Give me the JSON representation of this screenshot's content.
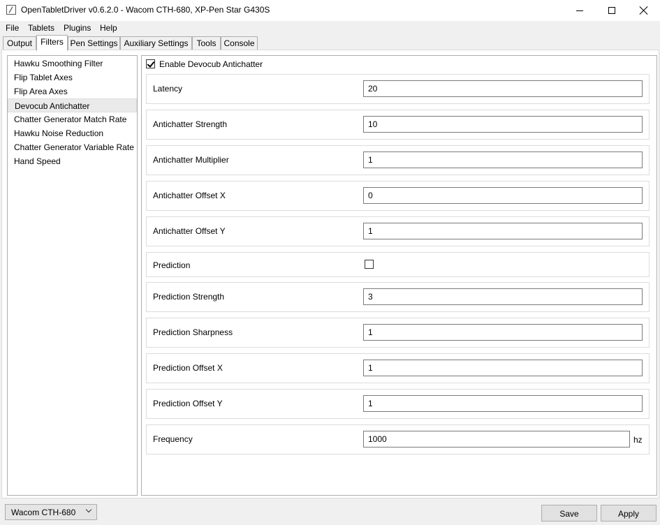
{
  "window": {
    "title": "OpenTabletDriver v0.6.2.0 - Wacom CTH-680, XP-Pen Star G430S"
  },
  "menu": {
    "items": [
      "File",
      "Tablets",
      "Plugins",
      "Help"
    ]
  },
  "tabs": {
    "items": [
      "Output",
      "Filters",
      "Pen Settings",
      "Auxiliary Settings",
      "Tools",
      "Console"
    ],
    "active": "Filters"
  },
  "filters": {
    "items": [
      "Hawku Smoothing Filter",
      "Flip Tablet Axes",
      "Flip Area Axes",
      "Devocub Antichatter",
      "Chatter Generator Match Rate",
      "Hawku Noise Reduction",
      "Chatter Generator Variable Rate",
      "Hand Speed"
    ],
    "selected": "Devocub Antichatter"
  },
  "settings": {
    "enable_label": "Enable Devocub Antichatter",
    "enable_checked": true,
    "latency": {
      "label": "Latency",
      "value": "20"
    },
    "antichatter_strength": {
      "label": "Antichatter Strength",
      "value": "10"
    },
    "antichatter_multiplier": {
      "label": "Antichatter Multiplier",
      "value": "1"
    },
    "antichatter_offset_x": {
      "label": "Antichatter Offset X",
      "value": "0"
    },
    "antichatter_offset_y": {
      "label": "Antichatter Offset Y",
      "value": "1"
    },
    "prediction": {
      "label": "Prediction",
      "checked": false
    },
    "prediction_strength": {
      "label": "Prediction Strength",
      "value": "3"
    },
    "prediction_sharpness": {
      "label": "Prediction Sharpness",
      "value": "1"
    },
    "prediction_offset_x": {
      "label": "Prediction Offset X",
      "value": "1"
    },
    "prediction_offset_y": {
      "label": "Prediction Offset Y",
      "value": "1"
    },
    "frequency": {
      "label": "Frequency",
      "value": "1000",
      "unit": "hz"
    }
  },
  "footer": {
    "tablet": "Wacom CTH-680",
    "save_label": "Save",
    "apply_label": "Apply"
  }
}
